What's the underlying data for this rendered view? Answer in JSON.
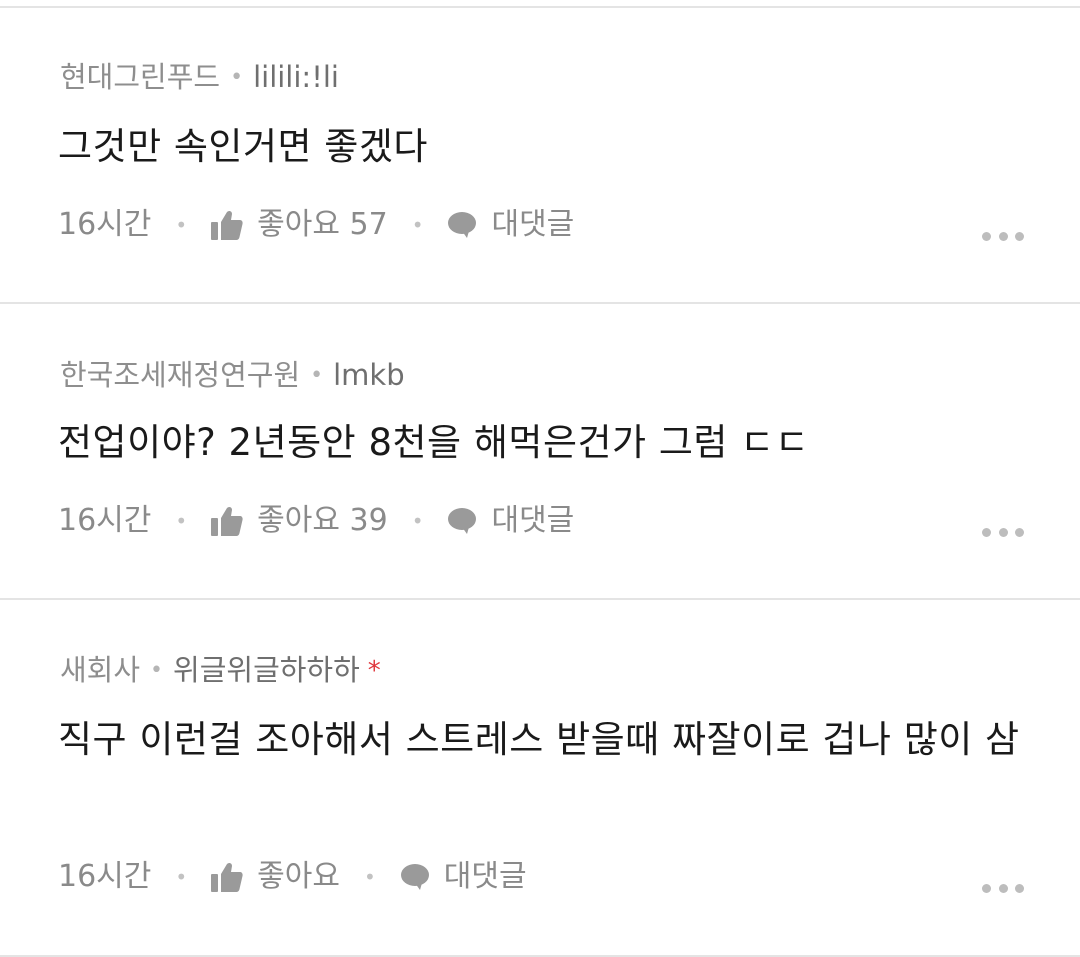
{
  "comments": [
    {
      "company": "현대그린푸드",
      "nickname": "lilili:!li",
      "has_badge": false,
      "text": "그것만 속인거면 좋겠다",
      "time": "16시간",
      "like_label": "좋아요 57",
      "reply_label": "대댓글"
    },
    {
      "company": "한국조세재정연구원",
      "nickname": "lmkb",
      "has_badge": false,
      "text": "전업이야? 2년동안 8천을 해먹은건가 그럼 ㄷㄷ",
      "time": "16시간",
      "like_label": "좋아요 39",
      "reply_label": "대댓글"
    },
    {
      "company": "새회사",
      "nickname": "위글위글하하하",
      "has_badge": true,
      "badge": "*",
      "text": "직구 이런걸 조아해서 스트레스 받을때 짜잘이로 겁나 많이 삼",
      "time": "16시간",
      "like_label": "좋아요",
      "reply_label": "대댓글"
    }
  ],
  "separator_dot": "•",
  "icons": {
    "like": "thumbs-up-icon",
    "reply": "speech-bubble-icon",
    "more": "more-horizontal-icon"
  },
  "colors": {
    "text_primary": "#1a1a1a",
    "text_secondary": "#8a8a8a",
    "badge": "#e0383e",
    "divider": "#e4e4e4"
  }
}
